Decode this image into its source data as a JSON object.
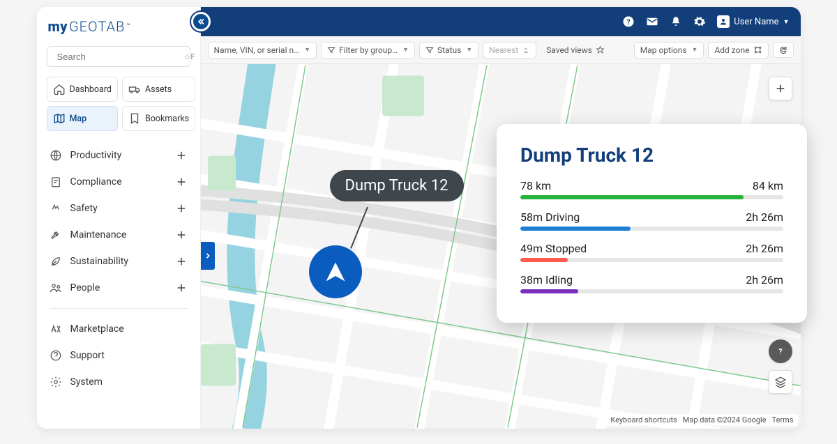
{
  "brand": {
    "my": "my",
    "geotab": "GEOTAB",
    "tm": "™"
  },
  "search": {
    "placeholder": "Search",
    "kbd": "☆F"
  },
  "sidebar": {
    "tabs": [
      {
        "label": "Dashboard"
      },
      {
        "label": "Assets"
      },
      {
        "label": "Map"
      },
      {
        "label": "Bookmarks"
      }
    ],
    "nav": [
      {
        "label": "Productivity"
      },
      {
        "label": "Compliance"
      },
      {
        "label": "Safety"
      },
      {
        "label": "Maintenance"
      },
      {
        "label": "Sustainability"
      },
      {
        "label": "People"
      }
    ],
    "footer": [
      {
        "label": "Marketplace"
      },
      {
        "label": "Support"
      },
      {
        "label": "System"
      }
    ]
  },
  "topbar": {
    "user": "User Name"
  },
  "filter": {
    "name_placeholder": "Name, VIN, or serial n…",
    "group": "Filter by group…",
    "status": "Status",
    "nearest": "Nearest",
    "saved": "Saved views",
    "mapopts": "Map options",
    "addzone": "Add zone"
  },
  "tooltip": {
    "title": "Dump Truck 12"
  },
  "detail": {
    "title": "Dump Truck 12",
    "metrics": [
      {
        "left": "78 km",
        "right": "84 km",
        "pct": 85,
        "color": "#27b43a"
      },
      {
        "left": "58m Driving",
        "right": "2h 26m",
        "pct": 42,
        "color": "#1c7fd6"
      },
      {
        "left": "49m Stopped",
        "right": "2h 26m",
        "pct": 18,
        "color": "#ff5a4d"
      },
      {
        "left": "38m Idling",
        "right": "2h 26m",
        "pct": 22,
        "color": "#7b2fbf"
      }
    ]
  },
  "map_attrib": {
    "shortcuts": "Keyboard shortcuts",
    "data": "Map data ©2024 Google",
    "terms": "Terms"
  }
}
